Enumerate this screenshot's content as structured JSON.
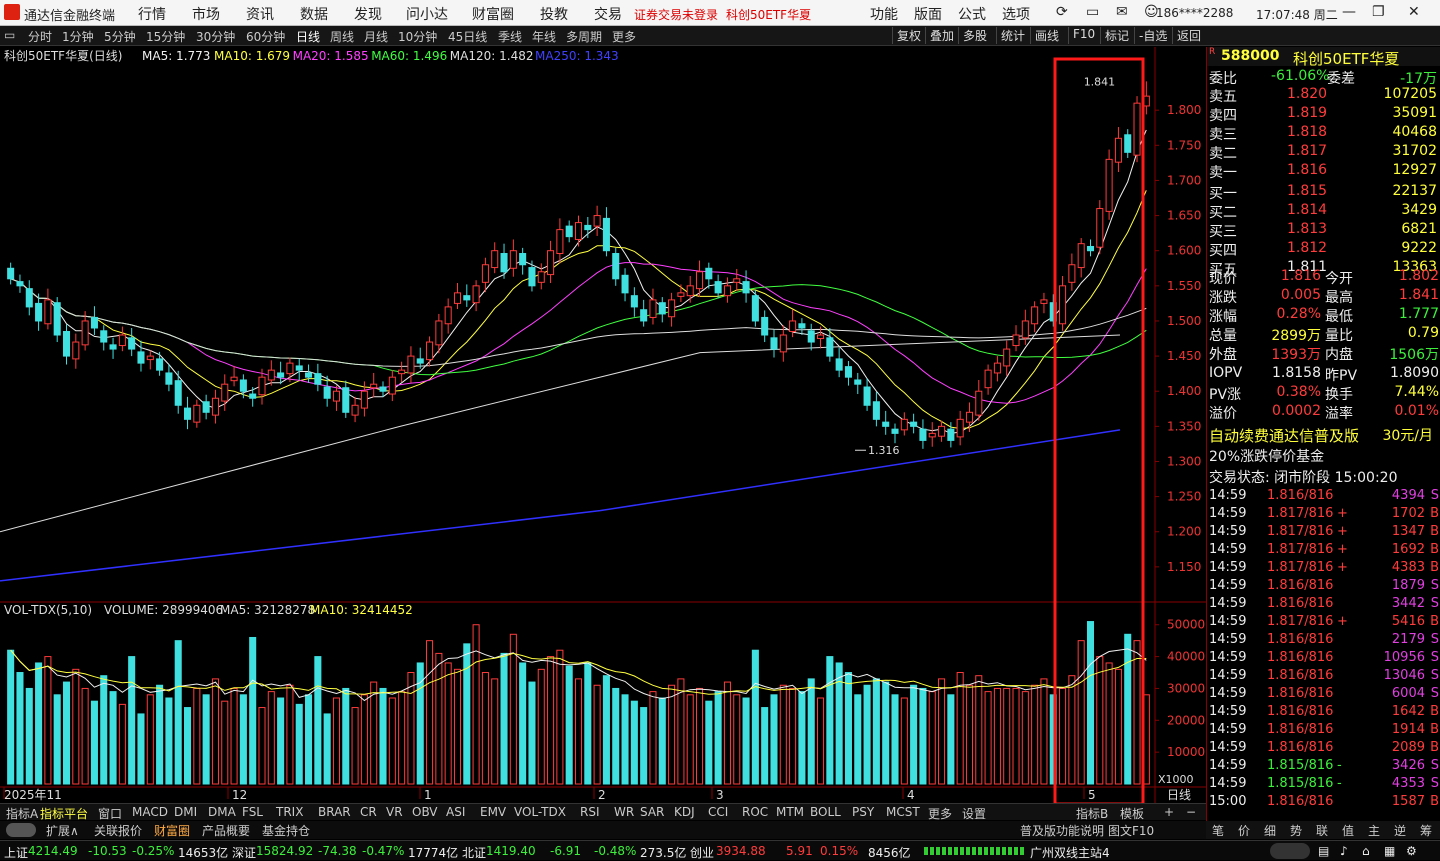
{
  "app": {
    "title": "通达信金融终端",
    "menu": [
      "行情",
      "市场",
      "资讯",
      "数据",
      "发现",
      "问小达",
      "财富圈",
      "投教",
      "交易"
    ],
    "notice": "证券交易未登录",
    "notice_stock": "科创50ETF华夏",
    "right_menu": [
      "功能",
      "版面",
      "公式",
      "选项"
    ],
    "user": "186****2288",
    "time": "17:07:48 周二"
  },
  "periods": [
    "分时",
    "1分钟",
    "5分钟",
    "15分钟",
    "30分钟",
    "60分钟",
    "日线",
    "周线",
    "月线",
    "10分钟",
    "45日线",
    "季线",
    "年线",
    "多周期",
    "更多"
  ],
  "active_period": "日线",
  "right_tools": [
    "复权",
    "叠加",
    "多股",
    "统计",
    "画线",
    "F10",
    "标记",
    "-自选",
    "返回"
  ],
  "main_chart": {
    "title": "科创50ETF华夏(日线)",
    "ma": [
      {
        "label": "MA5: 1.773",
        "color": "#f0f0f0"
      },
      {
        "label": "MA10: 1.679",
        "color": "#ffff40"
      },
      {
        "label": "MA20: 1.585",
        "color": "#ff40ff"
      },
      {
        "label": "MA60: 1.496",
        "color": "#40ff40"
      },
      {
        "label": "MA120: 1.482",
        "color": "#dddddd"
      },
      {
        "label": "MA250: 1.343",
        "color": "#4040ff"
      }
    ],
    "price_ticks": [
      "1.800",
      "1.750",
      "1.700",
      "1.650",
      "1.600",
      "1.550",
      "1.500",
      "1.450",
      "1.400",
      "1.350",
      "1.300",
      "1.250",
      "1.200",
      "1.150"
    ],
    "high_label": "1.841",
    "low_label": "1.316"
  },
  "vol_chart": {
    "title": "VOL-TDX(5,10)",
    "volume": "VOLUME: 28999406",
    "ma5": "MA5: 32128278",
    "ma10": "MA10: 32414452",
    "ticks": [
      "50000",
      "40000",
      "30000",
      "20000",
      "10000"
    ],
    "unit": "X1000"
  },
  "date_axis": [
    "2025年11",
    "12",
    "1",
    "2",
    "3",
    "4",
    "5"
  ],
  "date_axis_right": "日线",
  "chart_data": {
    "type": "candlestick",
    "ylim": [
      1.1,
      1.87
    ],
    "high": 1.841,
    "low": 1.316,
    "closes": [
      1.56,
      1.55,
      1.52,
      1.5,
      1.53,
      1.48,
      1.45,
      1.47,
      1.5,
      1.49,
      1.47,
      1.46,
      1.48,
      1.46,
      1.44,
      1.45,
      1.43,
      1.41,
      1.38,
      1.36,
      1.38,
      1.37,
      1.39,
      1.41,
      1.42,
      1.4,
      1.39,
      1.42,
      1.43,
      1.42,
      1.44,
      1.43,
      1.42,
      1.41,
      1.39,
      1.4,
      1.37,
      1.38,
      1.4,
      1.41,
      1.4,
      1.42,
      1.43,
      1.45,
      1.44,
      1.47,
      1.5,
      1.52,
      1.54,
      1.53,
      1.55,
      1.58,
      1.6,
      1.57,
      1.6,
      1.58,
      1.55,
      1.57,
      1.6,
      1.63,
      1.62,
      1.64,
      1.63,
      1.65,
      1.6,
      1.56,
      1.54,
      1.52,
      1.5,
      1.53,
      1.51,
      1.53,
      1.54,
      1.55,
      1.57,
      1.56,
      1.54,
      1.55,
      1.56,
      1.54,
      1.5,
      1.48,
      1.46,
      1.48,
      1.5,
      1.49,
      1.47,
      1.48,
      1.45,
      1.43,
      1.42,
      1.41,
      1.38,
      1.36,
      1.35,
      1.34,
      1.36,
      1.35,
      1.33,
      1.34,
      1.35,
      1.33,
      1.36,
      1.37,
      1.4,
      1.43,
      1.44,
      1.46,
      1.48,
      1.5,
      1.52,
      1.53,
      1.5,
      1.55,
      1.58,
      1.61,
      1.6,
      1.66,
      1.73,
      1.76,
      1.74,
      1.81,
      1.82
    ],
    "volumes": [
      42,
      35,
      30,
      38,
      40,
      28,
      32,
      36,
      30,
      26,
      34,
      29,
      25,
      40,
      22,
      28,
      31,
      27,
      45,
      24,
      30,
      28,
      33,
      26,
      30,
      28,
      46,
      24,
      29,
      27,
      31,
      25,
      28,
      40,
      22,
      27,
      30,
      24,
      28,
      32,
      30,
      27,
      29,
      35,
      38,
      45,
      41,
      38,
      36,
      44,
      50,
      35,
      33,
      41,
      47,
      38,
      32,
      36,
      40,
      42,
      37,
      33,
      38,
      31,
      34,
      30,
      28,
      26,
      24,
      29,
      27,
      31,
      33,
      28,
      30,
      26,
      29,
      32,
      28,
      27,
      42,
      24,
      28,
      31,
      30,
      29,
      33,
      27,
      40,
      38,
      35,
      28,
      31,
      33,
      32,
      28,
      27,
      31,
      30,
      29,
      33,
      28,
      35,
      31,
      34,
      29,
      30,
      30,
      30,
      29,
      31,
      33,
      28,
      30,
      34,
      45,
      51,
      40,
      38,
      36,
      47,
      45,
      28
    ]
  },
  "quote": {
    "code": "588000",
    "name": "科创50ETF华夏",
    "weibi_label": "委比",
    "weibi": "-61.06%",
    "weicha_label": "委差",
    "weicha": "-17万",
    "asks": [
      {
        "label": "卖五",
        "price": "1.820",
        "vol": "107205"
      },
      {
        "label": "卖四",
        "price": "1.819",
        "vol": "35091"
      },
      {
        "label": "卖三",
        "price": "1.818",
        "vol": "40468"
      },
      {
        "label": "卖二",
        "price": "1.817",
        "vol": "31702"
      },
      {
        "label": "卖一",
        "price": "1.816",
        "vol": "12927"
      }
    ],
    "bids": [
      {
        "label": "买一",
        "price": "1.815",
        "vol": "22137"
      },
      {
        "label": "买二",
        "price": "1.814",
        "vol": "3429"
      },
      {
        "label": "买三",
        "price": "1.813",
        "vol": "6821"
      },
      {
        "label": "买四",
        "price": "1.812",
        "vol": "9222"
      },
      {
        "label": "买五",
        "price": "1.811",
        "vol": "13363"
      }
    ],
    "stats": [
      {
        "l1": "现价",
        "v1": "1.816",
        "c1": "up",
        "l2": "今开",
        "v2": "1.802",
        "c2": "up"
      },
      {
        "l1": "涨跌",
        "v1": "0.005",
        "c1": "up",
        "l2": "最高",
        "v2": "1.841",
        "c2": "up"
      },
      {
        "l1": "涨幅",
        "v1": "0.28%",
        "c1": "up",
        "l2": "最低",
        "v2": "1.777",
        "c2": "dn"
      },
      {
        "l1": "总量",
        "v1": "2899万",
        "c1": "yl",
        "l2": "量比",
        "v2": "0.79",
        "c2": "yl"
      },
      {
        "l1": "外盘",
        "v1": "1393万",
        "c1": "up",
        "l2": "内盘",
        "v2": "1506万",
        "c2": "dn"
      }
    ],
    "iopv": [
      {
        "l1": "IOPV",
        "v1": "1.8158",
        "c1": "wh",
        "l2": "昨PV",
        "v2": "1.8090",
        "c2": "wh"
      },
      {
        "l1": "PV涨",
        "v1": "0.38%",
        "c1": "up",
        "l2": "换手",
        "v2": "7.44%",
        "c2": "yl"
      },
      {
        "l1": "溢价",
        "v1": "0.0002",
        "c1": "up",
        "l2": "溢率",
        "v2": "0.01%",
        "c2": "up"
      }
    ],
    "promo": "自动续费通达信普及版",
    "promo_price": "30元/月",
    "limit": "20%涨跌停价基金",
    "trade_state": "交易状态: 闭市阶段 15:00:20"
  },
  "ticks": [
    {
      "t": "14:59",
      "p": "1.816/816",
      "s": "",
      "v": "4394",
      "bs": "S"
    },
    {
      "t": "14:59",
      "p": "1.817/816",
      "s": "+",
      "v": "1702",
      "bs": "B"
    },
    {
      "t": "14:59",
      "p": "1.817/816",
      "s": "+",
      "v": "1347",
      "bs": "B"
    },
    {
      "t": "14:59",
      "p": "1.817/816",
      "s": "+",
      "v": "1692",
      "bs": "B"
    },
    {
      "t": "14:59",
      "p": "1.817/816",
      "s": "+",
      "v": "4383",
      "bs": "B"
    },
    {
      "t": "14:59",
      "p": "1.816/816",
      "s": "",
      "v": "1879",
      "bs": "S"
    },
    {
      "t": "14:59",
      "p": "1.816/816",
      "s": "",
      "v": "3442",
      "bs": "S"
    },
    {
      "t": "14:59",
      "p": "1.817/816",
      "s": "+",
      "v": "5416",
      "bs": "B"
    },
    {
      "t": "14:59",
      "p": "1.816/816",
      "s": "",
      "v": "2179",
      "bs": "S"
    },
    {
      "t": "14:59",
      "p": "1.816/816",
      "s": "",
      "v": "10956",
      "bs": "S"
    },
    {
      "t": "14:59",
      "p": "1.816/816",
      "s": "",
      "v": "13046",
      "bs": "S"
    },
    {
      "t": "14:59",
      "p": "1.816/816",
      "s": "",
      "v": "6004",
      "bs": "S"
    },
    {
      "t": "14:59",
      "p": "1.816/816",
      "s": "",
      "v": "1642",
      "bs": "B"
    },
    {
      "t": "14:59",
      "p": "1.816/816",
      "s": "",
      "v": "1914",
      "bs": "B"
    },
    {
      "t": "14:59",
      "p": "1.816/816",
      "s": "",
      "v": "2089",
      "bs": "B"
    },
    {
      "t": "14:59",
      "p": "1.815/816",
      "s": "-",
      "v": "3426",
      "bs": "S"
    },
    {
      "t": "14:59",
      "p": "1.815/816",
      "s": "-",
      "v": "4353",
      "bs": "S"
    },
    {
      "t": "15:00",
      "p": "1.816/816",
      "s": "",
      "v": "1587",
      "bs": "B"
    }
  ],
  "indicator_tabs": [
    "指标A",
    "指标平台",
    "窗口",
    "MACD",
    "DMI",
    "DMA",
    "FSL",
    "TRIX",
    "BRAR",
    "CR",
    "VR",
    "OBV",
    "ASI",
    "EMV",
    "VOL-TDX",
    "RSI",
    "WR",
    "SAR",
    "KDJ",
    "CCI",
    "ROC",
    "MTM",
    "BOLL",
    "PSY",
    "MCST",
    "更多",
    "设置"
  ],
  "indicator_right": [
    "指标B",
    "模板"
  ],
  "bottom_tabs": [
    "扩展∧",
    "关联报价",
    "财富圈",
    "产品概要",
    "基金持仓"
  ],
  "bottom_right": "普及版功能说明",
  "bottom_right2": "图文F10",
  "right_tabs": [
    "笔",
    "价",
    "细",
    "势",
    "联",
    "值",
    "主",
    "逆",
    "筹"
  ],
  "status": {
    "sh_label": "上证",
    "sh": "4214.49",
    "sh_chg": "-10.53",
    "sh_pct": "-0.25%",
    "sh_amt": "14653亿",
    "sz_label": "深证",
    "sz": "15824.92",
    "sz_chg": "-74.38",
    "sz_pct": "-0.47%",
    "sz_amt": "17774亿",
    "bz_label": "北证",
    "bz": "1419.40",
    "bz_chg": "-6.91",
    "bz_pct": "-0.48%",
    "bz_amt": "273.5亿",
    "cy_label": "创业",
    "cy": "3934.88",
    "cy_chg": "5.91",
    "cy_pct": "0.15%",
    "cy_amt": "8456亿",
    "server": "广州双线主站4"
  }
}
